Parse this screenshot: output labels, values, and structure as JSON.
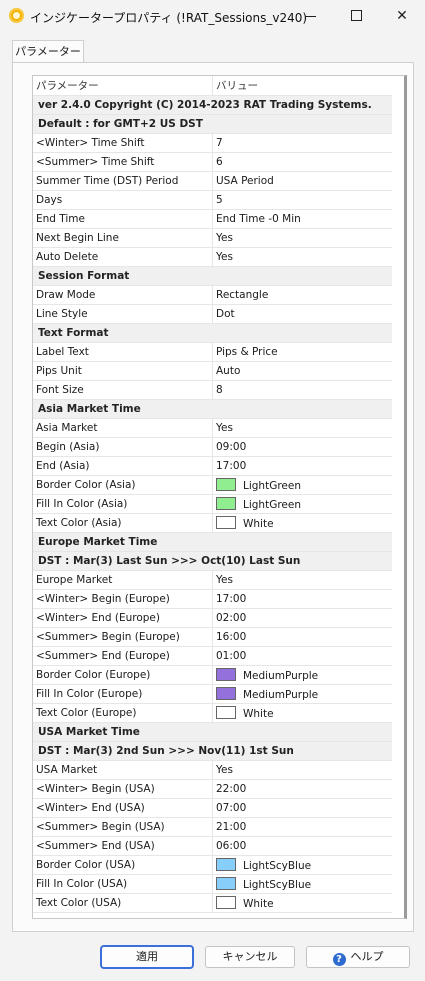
{
  "window": {
    "title": "インジケータープロパティ (!RAT_Sessions_v240)",
    "minimize": "",
    "maximize": "",
    "close": "✕"
  },
  "tab": {
    "label": "パラメーター"
  },
  "grid": {
    "header": {
      "param": "パラメーター",
      "value": "バリュー"
    },
    "rows": [
      {
        "type": "section",
        "label": "ver 2.4.0 Copyright (C) 2014-2023 RAT Trading Systems."
      },
      {
        "type": "section",
        "label": "Default : for GMT+2 US DST"
      },
      {
        "type": "param",
        "name": "<Winter> Time Shift",
        "value": "7"
      },
      {
        "type": "param",
        "name": "<Summer> Time Shift",
        "value": "6"
      },
      {
        "type": "param",
        "name": "Summer Time (DST) Period",
        "value": "USA Period"
      },
      {
        "type": "param",
        "name": "Days",
        "value": "5"
      },
      {
        "type": "param",
        "name": "End Time",
        "value": "End Time -0 Min"
      },
      {
        "type": "param",
        "name": "Next Begin Line",
        "value": "Yes"
      },
      {
        "type": "param",
        "name": "Auto Delete",
        "value": "Yes"
      },
      {
        "type": "section",
        "label": "Session Format"
      },
      {
        "type": "param",
        "name": "Draw Mode",
        "value": "Rectangle"
      },
      {
        "type": "param",
        "name": "Line Style",
        "value": "Dot"
      },
      {
        "type": "section",
        "label": "Text Format"
      },
      {
        "type": "param",
        "name": "Label Text",
        "value": "Pips & Price"
      },
      {
        "type": "param",
        "name": "Pips Unit",
        "value": "Auto"
      },
      {
        "type": "param",
        "name": "Font Size",
        "value": "8"
      },
      {
        "type": "section",
        "label": "Asia Market Time"
      },
      {
        "type": "param",
        "name": "Asia Market",
        "value": "Yes"
      },
      {
        "type": "param",
        "name": "Begin (Asia)",
        "value": "09:00"
      },
      {
        "type": "param",
        "name": "End (Asia)",
        "value": "17:00"
      },
      {
        "type": "param",
        "name": "Border Color (Asia)",
        "value": "LightGreen",
        "color": "#90ee90"
      },
      {
        "type": "param",
        "name": "Fill In Color (Asia)",
        "value": "LightGreen",
        "color": "#90ee90"
      },
      {
        "type": "param",
        "name": "Text Color (Asia)",
        "value": "White",
        "color": "#ffffff"
      },
      {
        "type": "section",
        "label": "Europe Market Time"
      },
      {
        "type": "section",
        "label": "DST : Mar(3) Last Sun >>> Oct(10) Last Sun"
      },
      {
        "type": "param",
        "name": "Europe Market",
        "value": "Yes"
      },
      {
        "type": "param",
        "name": "<Winter> Begin (Europe)",
        "value": "17:00"
      },
      {
        "type": "param",
        "name": "<Winter> End (Europe)",
        "value": "02:00"
      },
      {
        "type": "param",
        "name": "<Summer> Begin (Europe)",
        "value": "16:00"
      },
      {
        "type": "param",
        "name": "<Summer> End (Europe)",
        "value": "01:00"
      },
      {
        "type": "param",
        "name": "Border Color (Europe)",
        "value": "MediumPurple",
        "color": "#9370db"
      },
      {
        "type": "param",
        "name": "Fill In Color (Europe)",
        "value": "MediumPurple",
        "color": "#9370db"
      },
      {
        "type": "param",
        "name": "Text Color (Europe)",
        "value": "White",
        "color": "#ffffff"
      },
      {
        "type": "section",
        "label": "USA Market Time"
      },
      {
        "type": "section",
        "label": "DST : Mar(3) 2nd Sun >>> Nov(11) 1st Sun"
      },
      {
        "type": "param",
        "name": "USA Market",
        "value": "Yes"
      },
      {
        "type": "param",
        "name": "<Winter> Begin (USA)",
        "value": "22:00"
      },
      {
        "type": "param",
        "name": "<Winter> End (USA)",
        "value": "07:00"
      },
      {
        "type": "param",
        "name": "<Summer> Begin (USA)",
        "value": "21:00"
      },
      {
        "type": "param",
        "name": "<Summer> End (USA)",
        "value": "06:00"
      },
      {
        "type": "param",
        "name": "Border Color (USA)",
        "value": "LightScyBlue",
        "color": "#87cefa"
      },
      {
        "type": "param",
        "name": "Fill In Color (USA)",
        "value": "LightScyBlue",
        "color": "#87cefa"
      },
      {
        "type": "param",
        "name": "Text Color (USA)",
        "value": "White",
        "color": "#ffffff"
      }
    ]
  },
  "buttons": {
    "apply": "適用",
    "cancel": "キャンセル",
    "help": "ヘルプ",
    "help_glyph": "?"
  }
}
